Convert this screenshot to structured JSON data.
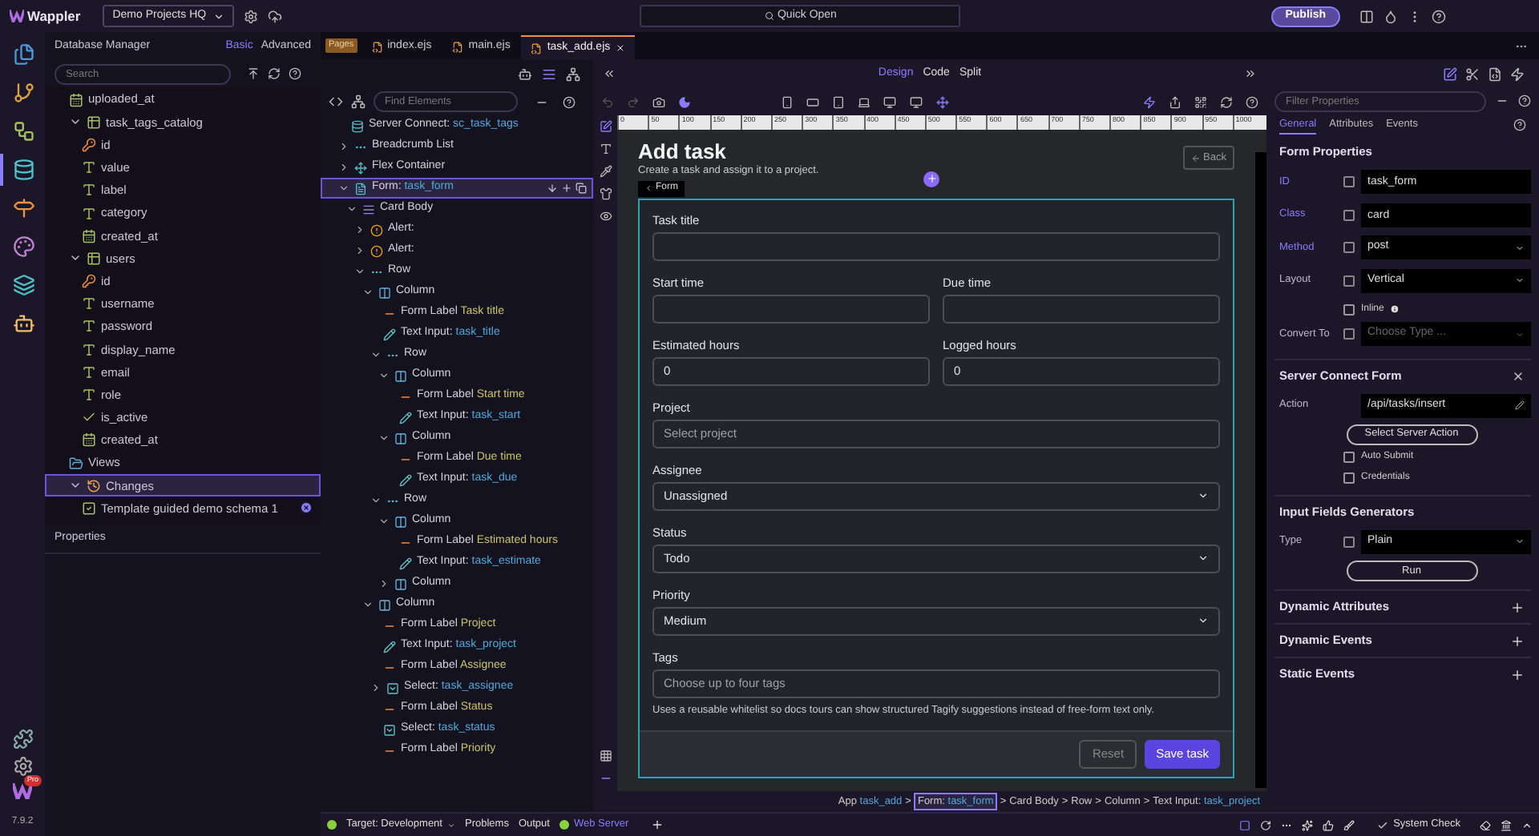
{
  "topbar": {
    "app_name": "Wappler",
    "project": "Demo Projects HQ",
    "quick_open": "Quick Open",
    "publish": "Publish"
  },
  "rail": {
    "items": [
      {
        "kind": "pages",
        "selected": false
      },
      {
        "kind": "git",
        "selected": false
      },
      {
        "kind": "flows",
        "selected": false
      },
      {
        "kind": "database",
        "selected": true
      },
      {
        "kind": "routes",
        "selected": false
      },
      {
        "kind": "design",
        "selected": false
      },
      {
        "kind": "layers",
        "selected": false
      },
      {
        "kind": "assistant",
        "selected": false
      }
    ],
    "badge": "Pro",
    "version": "7.9.2"
  },
  "database_manager": {
    "title": "Database Manager",
    "modes": [
      {
        "label": "Basic",
        "selected": true
      },
      {
        "label": "Advanced",
        "selected": false
      }
    ],
    "search": {
      "placeholder": "Search"
    },
    "properties_title": "Properties",
    "tree": [
      {
        "kind": "date",
        "label": "uploaded_at",
        "selected": false
      },
      {
        "kind": "table",
        "label": "task_tags_catalog",
        "expanded": true,
        "selected": false,
        "children": [
          {
            "kind": "key",
            "label": "id",
            "selected": false
          },
          {
            "kind": "text",
            "label": "value",
            "selected": false
          },
          {
            "kind": "text",
            "label": "label",
            "selected": false
          },
          {
            "kind": "text",
            "label": "category",
            "selected": false
          },
          {
            "kind": "date",
            "label": "created_at",
            "selected": false
          }
        ]
      },
      {
        "kind": "table",
        "label": "users",
        "expanded": true,
        "selected": false,
        "children": [
          {
            "kind": "key",
            "label": "id",
            "selected": false
          },
          {
            "kind": "text",
            "label": "username",
            "selected": false
          },
          {
            "kind": "text",
            "label": "password",
            "selected": false
          },
          {
            "kind": "text",
            "label": "display_name",
            "selected": false
          },
          {
            "kind": "text",
            "label": "email",
            "selected": false
          },
          {
            "kind": "text",
            "label": "role",
            "selected": false
          },
          {
            "kind": "bool",
            "label": "is_active",
            "selected": false
          },
          {
            "kind": "date",
            "label": "created_at",
            "selected": false
          }
        ]
      },
      {
        "kind": "folder",
        "label": "Views",
        "selected": false
      },
      {
        "kind": "history",
        "label": "Changes",
        "expanded": true,
        "selected": true,
        "children": [
          {
            "kind": "change",
            "label": "Template guided demo schema 1",
            "selected": false
          }
        ]
      }
    ]
  },
  "file_tabs": {
    "group": "Pages",
    "files": [
      {
        "label": "index.ejs",
        "selected": false
      },
      {
        "label": "main.ejs",
        "selected": false
      },
      {
        "label": "task_add.ejs",
        "selected": true
      }
    ]
  },
  "structure": {
    "find": {
      "placeholder": "Find Elements"
    },
    "tree": [
      {
        "kind": "server",
        "type": "Server Connect:",
        "name": "sc_task_tags",
        "selected": false
      },
      {
        "kind": "breadcrumb",
        "type": "Breadcrumb List",
        "expanded": false,
        "selected": false
      },
      {
        "kind": "flex",
        "type": "Flex Container",
        "expanded": false,
        "selected": false
      },
      {
        "kind": "form",
        "type": "Form:",
        "name": "task_form",
        "expanded": true,
        "selected": true,
        "children": [
          {
            "kind": "cardbody",
            "type": "Card Body",
            "expanded": true,
            "selected": false,
            "children": [
              {
                "kind": "alert",
                "type": "Alert:",
                "expanded": false,
                "selected": false
              },
              {
                "kind": "alert",
                "type": "Alert:",
                "expanded": false,
                "selected": false
              },
              {
                "kind": "row",
                "type": "Row",
                "expanded": true,
                "selected": false,
                "children": [
                  {
                    "kind": "column",
                    "type": "Column",
                    "expanded": true,
                    "selected": false,
                    "children": [
                      {
                        "kind": "label",
                        "type": "Form Label",
                        "name": "Task title",
                        "selected": false
                      },
                      {
                        "kind": "input",
                        "type": "Text Input:",
                        "name": "task_title",
                        "selected": false
                      },
                      {
                        "kind": "row",
                        "type": "Row",
                        "expanded": true,
                        "selected": false,
                        "children": [
                          {
                            "kind": "column",
                            "type": "Column",
                            "expanded": true,
                            "selected": false,
                            "children": [
                              {
                                "kind": "label",
                                "type": "Form Label",
                                "name": "Start time",
                                "selected": false
                              },
                              {
                                "kind": "input",
                                "type": "Text Input:",
                                "name": "task_start",
                                "selected": false
                              }
                            ]
                          },
                          {
                            "kind": "column",
                            "type": "Column",
                            "expanded": true,
                            "selected": false,
                            "children": [
                              {
                                "kind": "label",
                                "type": "Form Label",
                                "name": "Due time",
                                "selected": false
                              },
                              {
                                "kind": "input",
                                "type": "Text Input:",
                                "name": "task_due",
                                "selected": false
                              }
                            ]
                          }
                        ]
                      },
                      {
                        "kind": "row",
                        "type": "Row",
                        "expanded": true,
                        "selected": false,
                        "children": [
                          {
                            "kind": "column",
                            "type": "Column",
                            "expanded": true,
                            "selected": false,
                            "children": [
                              {
                                "kind": "label",
                                "type": "Form Label",
                                "name": "Estimated hours",
                                "selected": false
                              },
                              {
                                "kind": "input",
                                "type": "Text Input:",
                                "name": "task_estimate",
                                "selected": false
                              }
                            ]
                          },
                          {
                            "kind": "column",
                            "type": "Column",
                            "expanded": false,
                            "selected": false
                          }
                        ]
                      }
                    ]
                  },
                  {
                    "kind": "column",
                    "type": "Column",
                    "expanded": true,
                    "selected": false,
                    "children": [
                      {
                        "kind": "label",
                        "type": "Form Label",
                        "name": "Project",
                        "selected": false
                      },
                      {
                        "kind": "input",
                        "type": "Text Input:",
                        "name": "task_project",
                        "selected": false
                      },
                      {
                        "kind": "label",
                        "type": "Form Label",
                        "name": "Assignee",
                        "selected": false
                      },
                      {
                        "kind": "select",
                        "type": "Select:",
                        "name": "task_assignee",
                        "expanded": false,
                        "selected": false
                      },
                      {
                        "kind": "label",
                        "type": "Form Label",
                        "name": "Status",
                        "selected": false
                      },
                      {
                        "kind": "select",
                        "type": "Select:",
                        "name": "task_status",
                        "selected": false
                      },
                      {
                        "kind": "label",
                        "type": "Form Label",
                        "name": "Priority",
                        "selected": false
                      }
                    ]
                  }
                ]
              }
            ]
          }
        ]
      }
    ]
  },
  "editor": {
    "modes": [
      {
        "label": "Design",
        "selected": true
      },
      {
        "label": "Code",
        "selected": false
      },
      {
        "label": "Split",
        "selected": false
      }
    ],
    "ruler": [
      "0",
      "50",
      "100",
      "150",
      "200",
      "250",
      "300",
      "350",
      "400",
      "450",
      "500",
      "550",
      "600",
      "650",
      "700",
      "750",
      "800",
      "850",
      "900",
      "950",
      "1000"
    ],
    "page": {
      "title": "Add task",
      "subtitle": "Create a task and assign it to a project.",
      "back": "Back",
      "form_tag": "Form",
      "rows": [
        [
          {
            "label": "Task title",
            "kind": "input"
          }
        ],
        [
          {
            "label": "Start time",
            "kind": "input"
          },
          {
            "label": "Due time",
            "kind": "input"
          }
        ],
        [
          {
            "label": "Estimated hours",
            "kind": "input",
            "value": "0"
          },
          {
            "label": "Logged hours",
            "kind": "input",
            "value": "0"
          }
        ],
        [
          {
            "label": "Project",
            "kind": "input",
            "placeholder": "Select project"
          }
        ],
        [
          {
            "label": "Assignee",
            "kind": "select",
            "value": "Unassigned"
          }
        ],
        [
          {
            "label": "Status",
            "kind": "select",
            "value": "Todo"
          }
        ],
        [
          {
            "label": "Priority",
            "kind": "select",
            "value": "Medium"
          }
        ],
        [
          {
            "label": "Tags",
            "kind": "input",
            "placeholder": "Choose up to four tags",
            "help": "Uses a reusable whitelist so docs tours can show structured Tagify suggestions instead of free-form text only."
          }
        ]
      ],
      "buttons": [
        {
          "label": "Reset",
          "kind": "secondary"
        },
        {
          "label": "Save task",
          "kind": "primary"
        }
      ]
    },
    "breadcrumb": {
      "separator": ">",
      "items": [
        {
          "type": "App",
          "name": "task_add",
          "selected": false
        },
        {
          "type": "Form:",
          "name": "task_form",
          "selected": true
        },
        {
          "type": "Card Body",
          "selected": false
        },
        {
          "type": "Row",
          "selected": false
        },
        {
          "type": "Column",
          "selected": false
        },
        {
          "type": "Text Input:",
          "name": "task_project",
          "selected": false
        }
      ]
    }
  },
  "properties": {
    "filter": {
      "placeholder": "Filter Properties"
    },
    "tabs": [
      {
        "label": "General",
        "selected": true
      },
      {
        "label": "Attributes",
        "selected": false
      },
      {
        "label": "Events",
        "selected": false
      }
    ],
    "sections": [
      {
        "title": "Form Properties",
        "expanded": true,
        "closable": false,
        "rows": [
          {
            "kind": "input",
            "label": "ID",
            "value": "task_form",
            "set": true
          },
          {
            "kind": "input",
            "label": "Class",
            "value": "card",
            "set": true
          },
          {
            "kind": "select",
            "label": "Method",
            "value": "post",
            "set": true
          },
          {
            "kind": "select",
            "label": "Layout",
            "value": "Vertical",
            "set": false
          },
          {
            "kind": "checkbox",
            "label": "Inline",
            "checked": false,
            "info": true
          },
          {
            "kind": "select",
            "label": "Convert To",
            "placeholder": "Choose Type ...",
            "set": false
          }
        ]
      },
      {
        "title": "Server Connect Form",
        "expanded": true,
        "closable": true,
        "rows": [
          {
            "kind": "action",
            "label": "Action",
            "value": "/api/tasks/insert"
          },
          {
            "kind": "button",
            "label": "Select Server Action"
          },
          {
            "kind": "checkbox",
            "label": "Auto Submit",
            "checked": false,
            "info": false
          },
          {
            "kind": "checkbox",
            "label": "Credentials",
            "checked": false,
            "info": false
          }
        ]
      },
      {
        "title": "Input Fields Generators",
        "expanded": true,
        "closable": false,
        "rows": [
          {
            "kind": "select",
            "label": "Type",
            "value": "Plain",
            "set": false
          },
          {
            "kind": "button",
            "label": "Run"
          }
        ]
      },
      {
        "title": "Dynamic Attributes",
        "expanded": false
      },
      {
        "title": "Dynamic Events",
        "expanded": false
      },
      {
        "title": "Static Events",
        "expanded": false
      }
    ]
  },
  "status_bar": {
    "target": "Target: Development",
    "items": [
      "Problems",
      "Output"
    ],
    "server": "Web Server",
    "system_check": "System Check"
  }
}
